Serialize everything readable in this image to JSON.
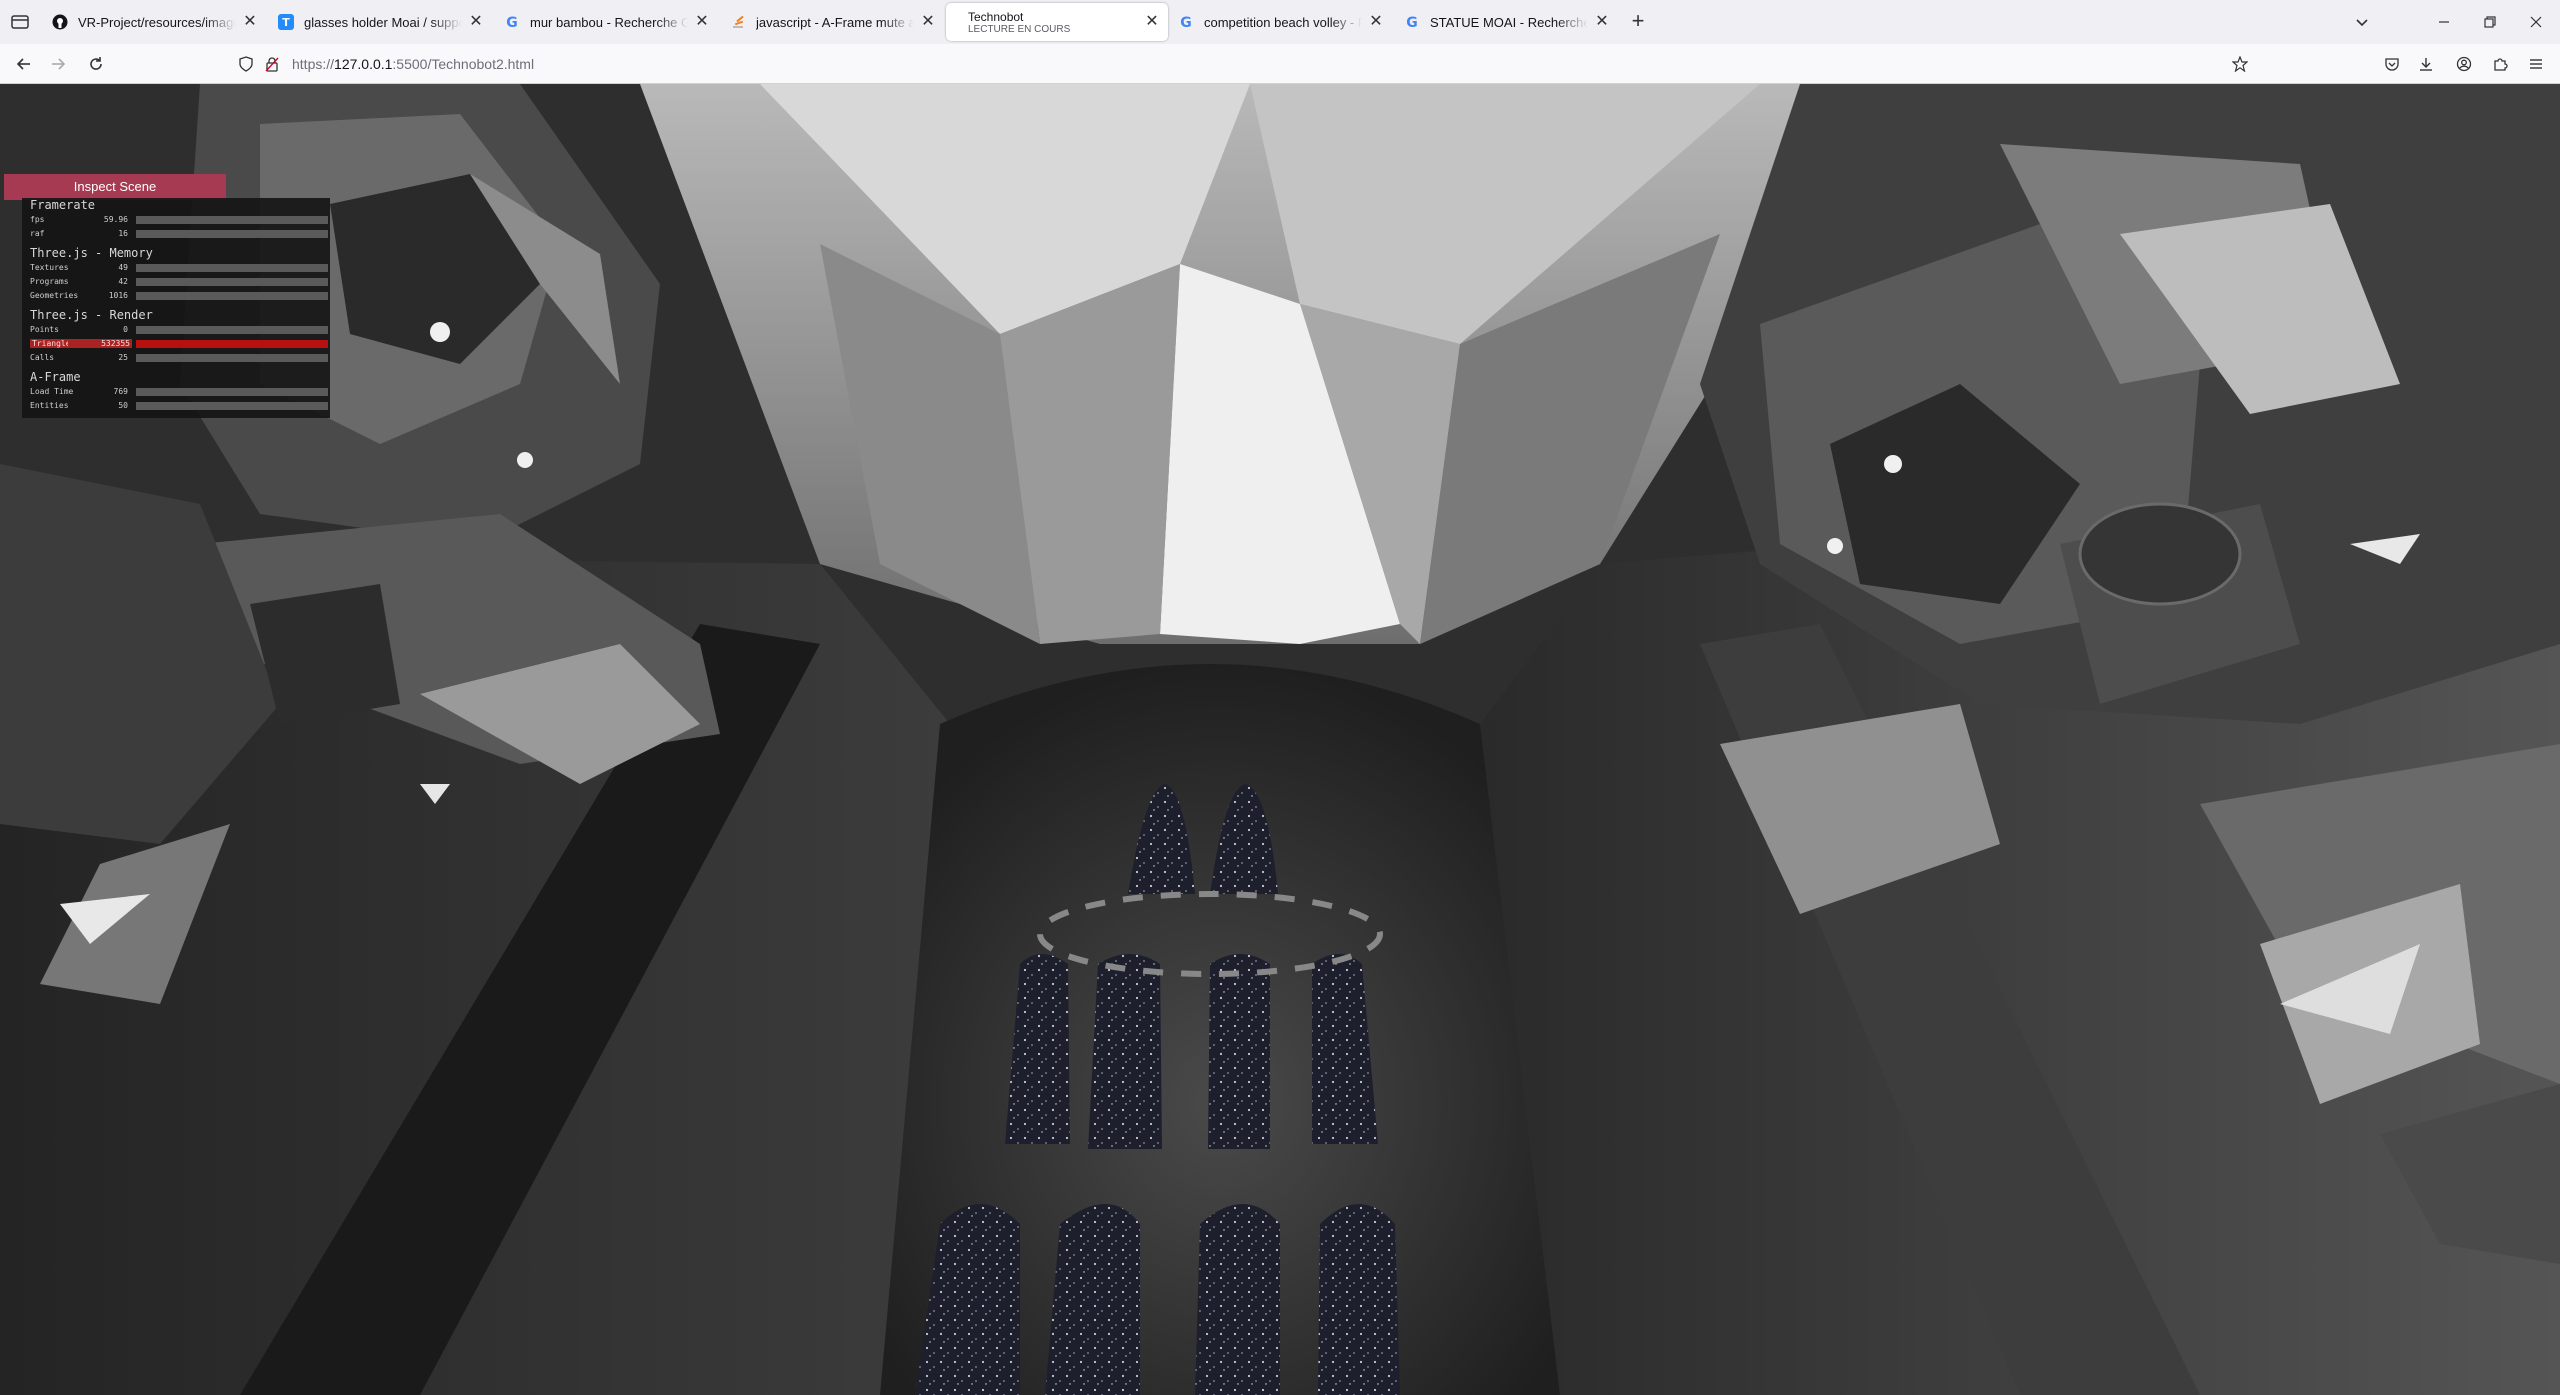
{
  "browser": {
    "tabs": [
      {
        "title": "VR-Project/resources/images at",
        "icon": "github-icon",
        "active": false
      },
      {
        "title": "glasses holder Moai / support lu",
        "icon": "thingiverse-icon",
        "active": false
      },
      {
        "title": "mur bambou - Recherche Google",
        "icon": "google-icon",
        "active": false
      },
      {
        "title": "javascript - A-Frame mute all so",
        "icon": "stackoverflow-icon",
        "active": false
      },
      {
        "title": "Technobot",
        "subtitle": "LECTURE EN COURS",
        "icon": "none",
        "active": true
      },
      {
        "title": "competition beach volley - Rech",
        "icon": "google-icon",
        "active": false
      },
      {
        "title": "STATUE MOAI - Recherche Goo",
        "icon": "google-icon",
        "active": false
      }
    ],
    "url_prefix": "https://",
    "url_host": "127.0.0.1",
    "url_path": ":5500/Technobot2.html"
  },
  "scene": {
    "inspect_label": "Inspect Scene",
    "stats": {
      "framerate_title": "Framerate",
      "fps_label": "fps",
      "fps_value": "59.96",
      "raf_label": "raf",
      "raf_value": "16",
      "memory_title": "Three.js - Memory",
      "textures_label": "Textures",
      "textures_value": "49",
      "programs_label": "Programs",
      "programs_value": "42",
      "geometries_label": "Geometries",
      "geometries_value": "1016",
      "render_title": "Three.js - Render",
      "points_label": "Points",
      "points_value": "0",
      "triangles_label": "Triangles",
      "triangles_value": "532355",
      "calls_label": "Calls",
      "calls_value": "25",
      "aframe_title": "A-Frame",
      "loadtime_label": "Load Time",
      "loadtime_value": "769",
      "entities_label": "Entities",
      "entities_value": "50"
    }
  },
  "colors": {
    "inspect_bg": "#a63a52",
    "alarm_bar": "#b81010",
    "tab_bar_bg": "#f0f0f4"
  }
}
